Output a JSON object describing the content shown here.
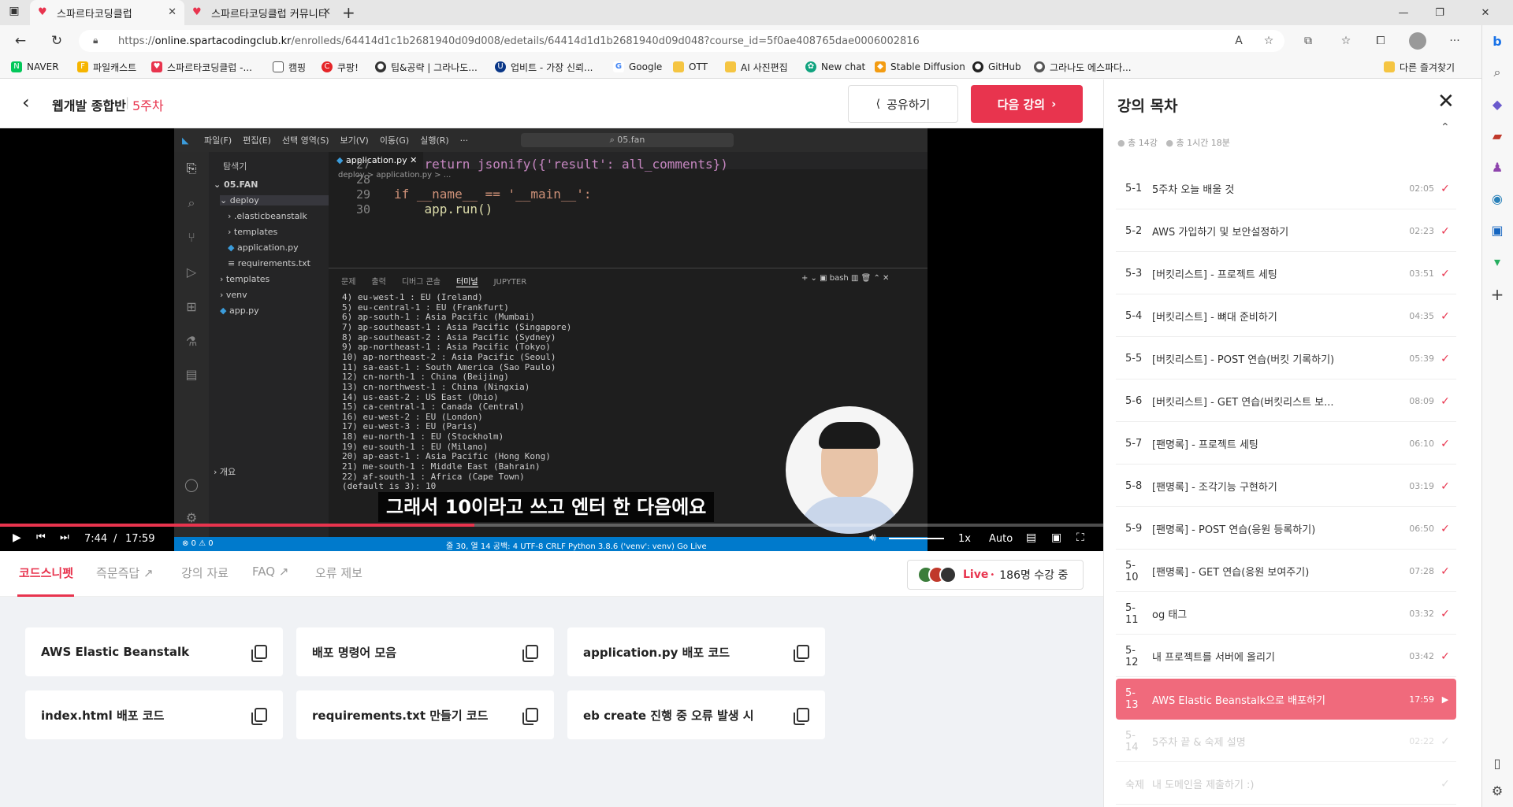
{
  "browser": {
    "tabs": [
      {
        "title": "스파르타코딩클럽"
      },
      {
        "title": "스파르타코딩클럽 커뮤니티 | 스"
      }
    ],
    "url_prefix": "https://",
    "url_host": "online.spartacodingclub.kr",
    "url_path": "/enrolleds/64414d1c1b2681940d09d008/edetails/64414d1d1b2681940d09d048?course_id=5f0ae408765dae0006002816",
    "bookmarks": [
      "NAVER",
      "파일캐스트",
      "스파르타코딩클럽 -...",
      "캠핑",
      "쿠팡!",
      "팁&공략 | 그라나도...",
      "업비트 - 가장 신뢰...",
      "Google",
      "OTT",
      "AI 사진편집",
      "New chat",
      "Stable Diffusion",
      "GitHub",
      "그라나도 에스파다..."
    ],
    "other_bookmarks": "다른 즐겨찾기"
  },
  "header": {
    "course": "웹개발 종합반",
    "separator": "|",
    "week": "5주차",
    "share_label": "공유하기",
    "next_label": "다음 강의"
  },
  "editor": {
    "menu": [
      "파일(F)",
      "편집(E)",
      "선택 영역(S)",
      "보기(V)",
      "이동(G)",
      "실행(R)",
      "···"
    ],
    "search": "05.fan",
    "explorer_title": "탐색기",
    "tree": [
      "05.FAN",
      "deploy",
      ".elasticbeanstalk",
      "templates",
      "application.py",
      "requirements.txt",
      "templates",
      "venv",
      "app.py"
    ],
    "outline": "개요",
    "tab_file": "application.py",
    "breadcrumb": "deploy > application.py > ...",
    "code": [
      {
        "n": "27",
        "text": "    return jsonify({'result': all_comments})"
      },
      {
        "n": "28",
        "text": ""
      },
      {
        "n": "29",
        "text": "if __name__ == '__main__':"
      },
      {
        "n": "30",
        "text": "    app.run()"
      }
    ],
    "panel_tabs": [
      "문제",
      "출력",
      "디버그 콘솔",
      "터미널",
      "JUPYTER"
    ],
    "shell": "bash",
    "terminal": [
      "4) eu-west-1 : EU (Ireland)",
      "5) eu-central-1 : EU (Frankfurt)",
      "6) ap-south-1 : Asia Pacific (Mumbai)",
      "7) ap-southeast-1 : Asia Pacific (Singapore)",
      "8) ap-southeast-2 : Asia Pacific (Sydney)",
      "9) ap-northeast-1 : Asia Pacific (Tokyo)",
      "10) ap-northeast-2 : Asia Pacific (Seoul)",
      "11) sa-east-1 : South America (Sao Paulo)",
      "12) cn-north-1 : China (Beijing)",
      "13) cn-northwest-1 : China (Ningxia)",
      "14) us-east-2 : US East (Ohio)",
      "15) ca-central-1 : Canada (Central)",
      "16) eu-west-2 : EU (London)",
      "17) eu-west-3 : EU (Paris)",
      "18) eu-north-1 : EU (Stockholm)",
      "19) eu-south-1 : EU (Milano)",
      "20) ap-east-1 : Asia Pacific (Hong Kong)",
      "21) me-south-1 : Middle East (Bahrain)",
      "22) af-south-1 : Africa (Cape Town)",
      "(default is 3): 10"
    ],
    "status": "줄 30, 열 14   공백: 4   UTF-8   CRLF   Python   3.8.6 ('venv': venv)   Go Live"
  },
  "video": {
    "subtitle": "그래서 10이라고 쓰고 엔터 한 다음에요",
    "current": "7:44",
    "slash": "/",
    "total": "17:59",
    "progress": 0.43,
    "speed": "1x",
    "quality": "Auto"
  },
  "lecture_tabs": [
    {
      "label": "코드스니펫"
    },
    {
      "label": "즉문즉답 ↗"
    },
    {
      "label": "강의 자료"
    },
    {
      "label": "FAQ ↗"
    },
    {
      "label": "오류 제보"
    }
  ],
  "live": {
    "label": "Live",
    "dot": "•",
    "count": "186명 수강 중"
  },
  "snippets": [
    "AWS Elastic Beanstalk",
    "배포 명령어 모음",
    "application.py 배포 코드",
    "index.html 배포 코드",
    "requirements.txt 만들기 코드",
    "eb create 진행 중 오류 발생 시"
  ],
  "toc": {
    "title": "강의 목차",
    "count": "총 14강",
    "duration": "총 1시간 18분",
    "items": [
      {
        "num": "5-1",
        "title": "5주차 오늘 배울 것",
        "dur": "02:05"
      },
      {
        "num": "5-2",
        "title": "AWS 가입하기 및 보안설정하기",
        "dur": "02:23"
      },
      {
        "num": "5-3",
        "title": "[버킷리스트] - 프로젝트 세팅",
        "dur": "03:51"
      },
      {
        "num": "5-4",
        "title": "[버킷리스트] - 뼈대 준비하기",
        "dur": "04:35"
      },
      {
        "num": "5-5",
        "title": "[버킷리스트] - POST 연습(버킷 기록하기)",
        "dur": "05:39"
      },
      {
        "num": "5-6",
        "title": "[버킷리스트] - GET 연습(버킷리스트 보...",
        "dur": "08:09"
      },
      {
        "num": "5-7",
        "title": "[팬명록] - 프로젝트 세팅",
        "dur": "06:10"
      },
      {
        "num": "5-8",
        "title": "[팬명록] - 조각기능 구현하기",
        "dur": "03:19"
      },
      {
        "num": "5-9",
        "title": "[팬명록] - POST 연습(응원 등록하기)",
        "dur": "06:50"
      },
      {
        "num": "5-10",
        "title": "[팬명록] - GET 연습(응원 보여주기)",
        "dur": "07:28"
      },
      {
        "num": "5-11",
        "title": "og 태그",
        "dur": "03:32"
      },
      {
        "num": "5-12",
        "title": "내 프로젝트를 서버에 올리기",
        "dur": "03:42"
      },
      {
        "num": "5-13",
        "title": "AWS Elastic Beanstalk으로 배포하기",
        "dur": "17:59"
      },
      {
        "num": "5-14",
        "title": "5주차 끝 & 숙제 설명",
        "dur": "02:22"
      },
      {
        "num": "숙제",
        "title": "내 도메인을 제출하기 :)",
        "dur": ""
      }
    ]
  },
  "colors": {
    "accent": "#e8344e",
    "vscode_status": "#007acc"
  }
}
